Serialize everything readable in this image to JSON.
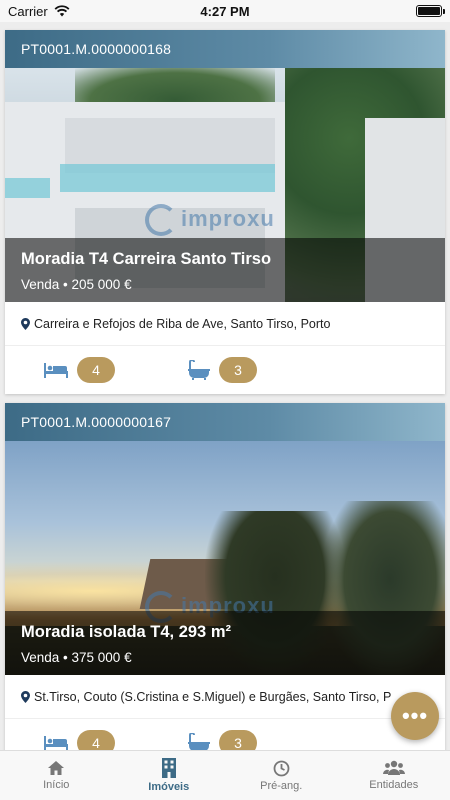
{
  "status_bar": {
    "carrier": "Carrier",
    "time": "4:27 PM",
    "battery_level": 1.0
  },
  "colors": {
    "header_blue": "#3d6b86",
    "accent_gold": "#b99a5e",
    "tab_active": "#3d6b86"
  },
  "listings": [
    {
      "reference": "PT0001.M.0000000168",
      "watermark": "improxu",
      "title": "Moradia T4 Carreira Santo Tirso",
      "price_line": "Venda • 205 000 €",
      "location": "Carreira e Refojos de Riba de Ave, Santo Tirso, Porto",
      "bedrooms": "4",
      "bathrooms": "3"
    },
    {
      "reference": "PT0001.M.0000000167",
      "watermark": "improxu",
      "title": "Moradia isolada T4, 293 m²",
      "price_line": "Venda • 375 000 €",
      "location": "St.Tirso, Couto (S.Cristina e S.Miguel) e Burgães, Santo Tirso, P",
      "bedrooms": "4",
      "bathrooms": "3"
    }
  ],
  "fab": {
    "label": "•••",
    "icon": "more-icon"
  },
  "tabs": [
    {
      "label": "Início",
      "icon": "home-icon",
      "active": false
    },
    {
      "label": "Imóveis",
      "icon": "building-icon",
      "active": true
    },
    {
      "label": "Pré-ang.",
      "icon": "clock-icon",
      "active": false
    },
    {
      "label": "Entidades",
      "icon": "people-icon",
      "active": false
    }
  ]
}
